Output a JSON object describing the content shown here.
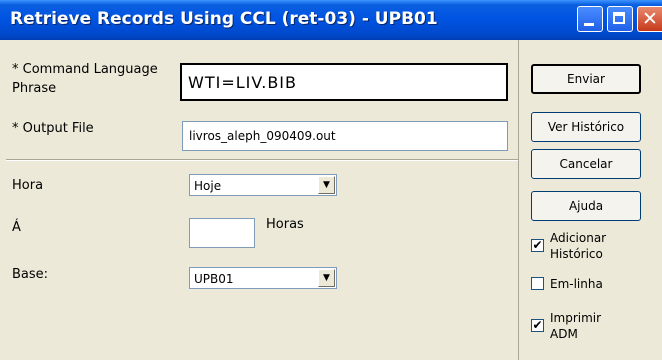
{
  "window": {
    "title": "Retrieve Records Using CCL (ret-03) - UPB01"
  },
  "form": {
    "ccl_label_line1": "* Command Language",
    "ccl_label_line2": "Phrase",
    "ccl_value": "WTI=LIV.BIB",
    "output_label": "* Output File",
    "output_value": "livros_aleph_090409.out",
    "hora_label": "Hora",
    "hora_value": "Hoje",
    "a_label": "Á",
    "horas_label": "Horas",
    "hours_value": "",
    "base_label": "Base:",
    "base_value": "UPB01"
  },
  "buttons": {
    "enviar": "Enviar",
    "ver_historico": "Ver Histórico",
    "cancelar": "Cancelar",
    "ajuda": "Ajuda"
  },
  "checkboxes": {
    "adicionar_line1": "Adicionar",
    "adicionar_line2": "Histórico",
    "adicionar_checked": true,
    "emlinha": "Em-linha",
    "emlinha_checked": false,
    "imprimir_line1": "Imprimir",
    "imprimir_line2": "ADM",
    "imprimir_checked": true
  },
  "icons": {
    "minimize": "minimize-icon",
    "maximize": "maximize-icon",
    "close": "close-icon",
    "dropdown": "chevron-down-icon",
    "check": "checkmark-icon"
  },
  "colors": {
    "titlebar": "#0054E3",
    "dialog_bg": "#ECE9D8",
    "close_button": "#C6391B"
  }
}
